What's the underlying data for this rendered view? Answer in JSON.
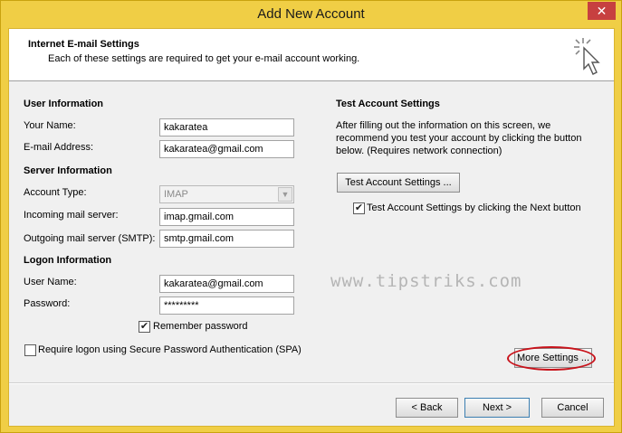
{
  "window": {
    "title": "Add New Account",
    "close_glyph": "✕",
    "close_icon": "close-icon"
  },
  "header": {
    "title": "Internet E-mail Settings",
    "subtitle": "Each of these settings are required to get your e-mail account working.",
    "icon": "cursor-click-icon"
  },
  "user_info": {
    "heading": "User Information",
    "name_label": "Your Name:",
    "name_value": "kakaratea",
    "email_label": "E-mail Address:",
    "email_value": "kakaratea@gmail.com"
  },
  "server_info": {
    "heading": "Server Information",
    "account_type_label": "Account Type:",
    "account_type_value": "IMAP",
    "incoming_label": "Incoming mail server:",
    "incoming_value": "imap.gmail.com",
    "outgoing_label": "Outgoing mail server (SMTP):",
    "outgoing_value": "smtp.gmail.com"
  },
  "logon_info": {
    "heading": "Logon Information",
    "username_label": "User Name:",
    "username_value": "kakaratea@gmail.com",
    "password_label": "Password:",
    "password_value": "*********",
    "remember_label": "Remember password",
    "remember_checked": true,
    "spa_label": "Require logon using Secure Password Authentication (SPA)",
    "spa_checked": false
  },
  "test_settings": {
    "heading": "Test Account Settings",
    "description": "After filling out the information on this screen, we recommend you test your account by clicking the button below. (Requires network connection)",
    "test_button": "Test Account Settings ...",
    "auto_test_label": "Test Account Settings by clicking the Next button",
    "auto_test_checked": true
  },
  "more_settings_button": "More Settings ...",
  "watermark": "www.tipstriks.com",
  "footer": {
    "back_button": "< Back",
    "next_button": "Next >",
    "cancel_button": "Cancel"
  },
  "check_glyph": "✔",
  "dropdown_glyph": "▼",
  "colors": {
    "titlebar": "#f0ce45",
    "close": "#c74040",
    "highlight_ring": "#c8131b"
  }
}
